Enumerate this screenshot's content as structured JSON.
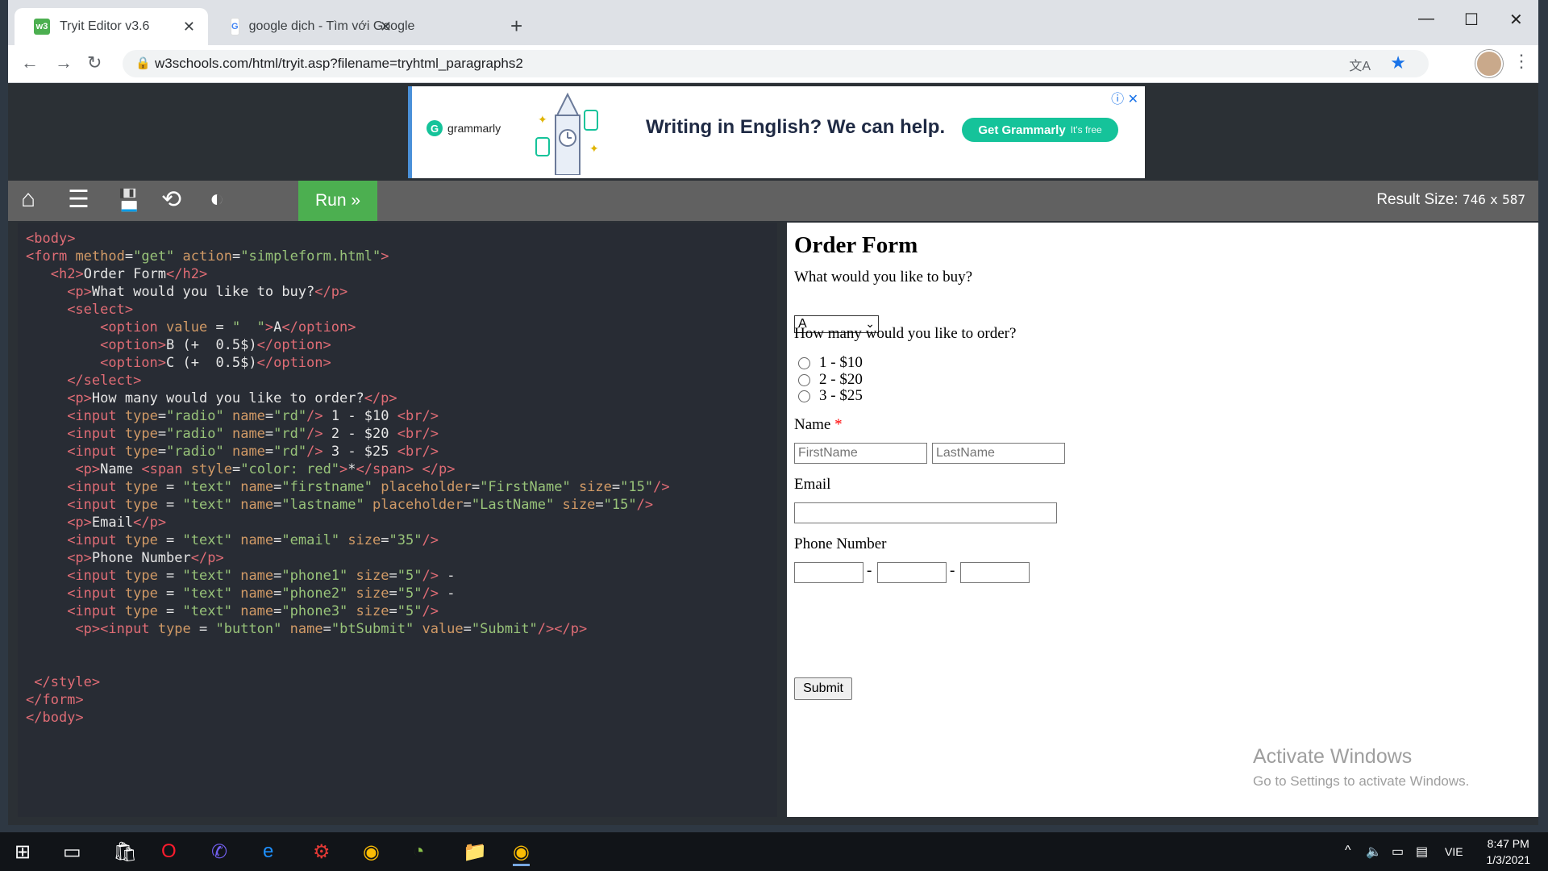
{
  "browser": {
    "tabs": [
      {
        "label": "Tryit Editor v3.6",
        "favicon": "w3schools-icon",
        "active": true
      },
      {
        "label": "google dịch - Tìm với Google",
        "favicon": "google-icon",
        "active": false
      }
    ],
    "url": "w3schools.com/html/tryit.asp?filename=tryhtml_paragraphs2"
  },
  "ad": {
    "brand": "grammarly",
    "headline": "Writing in English? We can help.",
    "cta": "Get Grammarly",
    "cta_note": "It's free"
  },
  "toolbar": {
    "run_label": "Run »",
    "result_size_label": "Result Size:",
    "result_width": "746",
    "result_x": "x",
    "result_height": "587"
  },
  "code_lines": [
    "<body>",
    "<form method=\"get\" action=\"simpleform.html\">",
    "   <h2>Order Form</h2>",
    "     <p>What would you like to buy?</p>",
    "     <select>",
    "         <option value = \"  \">A</option>",
    "         <option>B (+  0.5$)</option>",
    "         <option>C (+  0.5$)</option>",
    "     </select>",
    "     <p>How many would you like to order?</p>",
    "     <input type=\"radio\" name=\"rd\"/> 1 - $10 <br/>",
    "     <input type=\"radio\" name=\"rd\"/> 2 - $20 <br/>",
    "     <input type=\"radio\" name=\"rd\"/> 3 - $25 <br/>",
    "      <p>Name <span style=\"color: red\">*</span> </p>",
    "     <input type = \"text\" name=\"firstname\" placeholder=\"FirstName\" size=\"15\"/>",
    "     <input type = \"text\" name=\"lastname\" placeholder=\"LastName\" size=\"15\"/>",
    "     <p>Email</p>",
    "     <input type = \"text\" name=\"email\" size=\"35\"/>",
    "     <p>Phone Number</p>",
    "     <input type = \"text\" name=\"phone1\" size=\"5\"/> -",
    "     <input type = \"text\" name=\"phone2\" size=\"5\"/> -",
    "     <input type = \"text\" name=\"phone3\" size=\"5\"/>",
    "      <p><input type = \"button\" name=\"btSubmit\" value=\"Submit\"/></p>",
    "",
    "",
    " </style>",
    "</form>",
    "</body>"
  ],
  "form": {
    "title": "Order Form",
    "q1": "What would you like to buy?",
    "selected_option": "A",
    "q2": "How many would you like to order?",
    "radios": [
      "1 - $10",
      "2 - $20",
      "3 - $25"
    ],
    "name_label": "Name",
    "required_mark": "*",
    "firstname_placeholder": "FirstName",
    "lastname_placeholder": "LastName",
    "email_label": "Email",
    "phone_label": "Phone Number",
    "phone_sep": "-",
    "submit": "Submit"
  },
  "watermark": {
    "line1": "Activate Windows",
    "line2": "Go to Settings to activate Windows."
  },
  "taskbar": {
    "lang": "VIE",
    "time": "8:47 PM",
    "date": "1/3/2021"
  },
  "colors": {
    "run_green": "#4caf50",
    "editor_bg": "#282c34",
    "required_red": "#ff0000",
    "grammarly_green": "#15c39a"
  }
}
